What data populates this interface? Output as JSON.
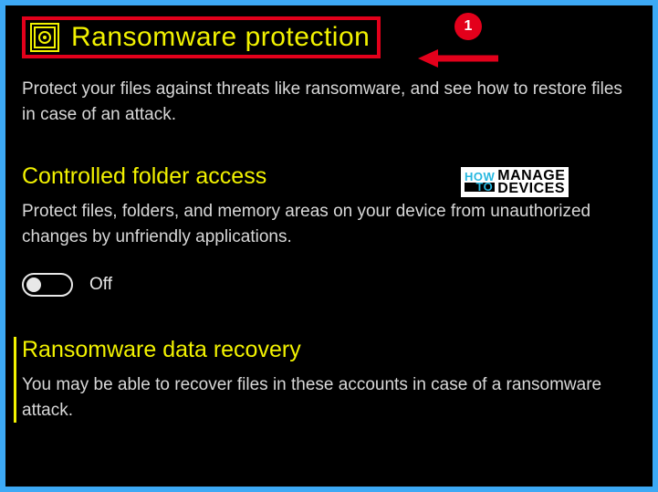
{
  "annotation": {
    "badge_number": "1"
  },
  "header": {
    "icon": "ransomware-shield-icon",
    "title": "Ransomware protection",
    "description": "Protect your files against threats like ransomware, and see how to restore files in case of an attack."
  },
  "sections": {
    "controlled_folder_access": {
      "heading": "Controlled folder access",
      "description": "Protect files, folders, and memory areas on your device from unauthorized changes by unfriendly applications.",
      "toggle_state": "Off",
      "toggle_on": false
    },
    "ransomware_data_recovery": {
      "heading": "Ransomware data recovery",
      "description": "You may be able to recover files in these accounts in case of a ransomware attack."
    }
  },
  "watermark": {
    "line1a": "HOW",
    "line1b": "TO",
    "line2a": "MANAGE",
    "line2b": "DEVICES"
  }
}
